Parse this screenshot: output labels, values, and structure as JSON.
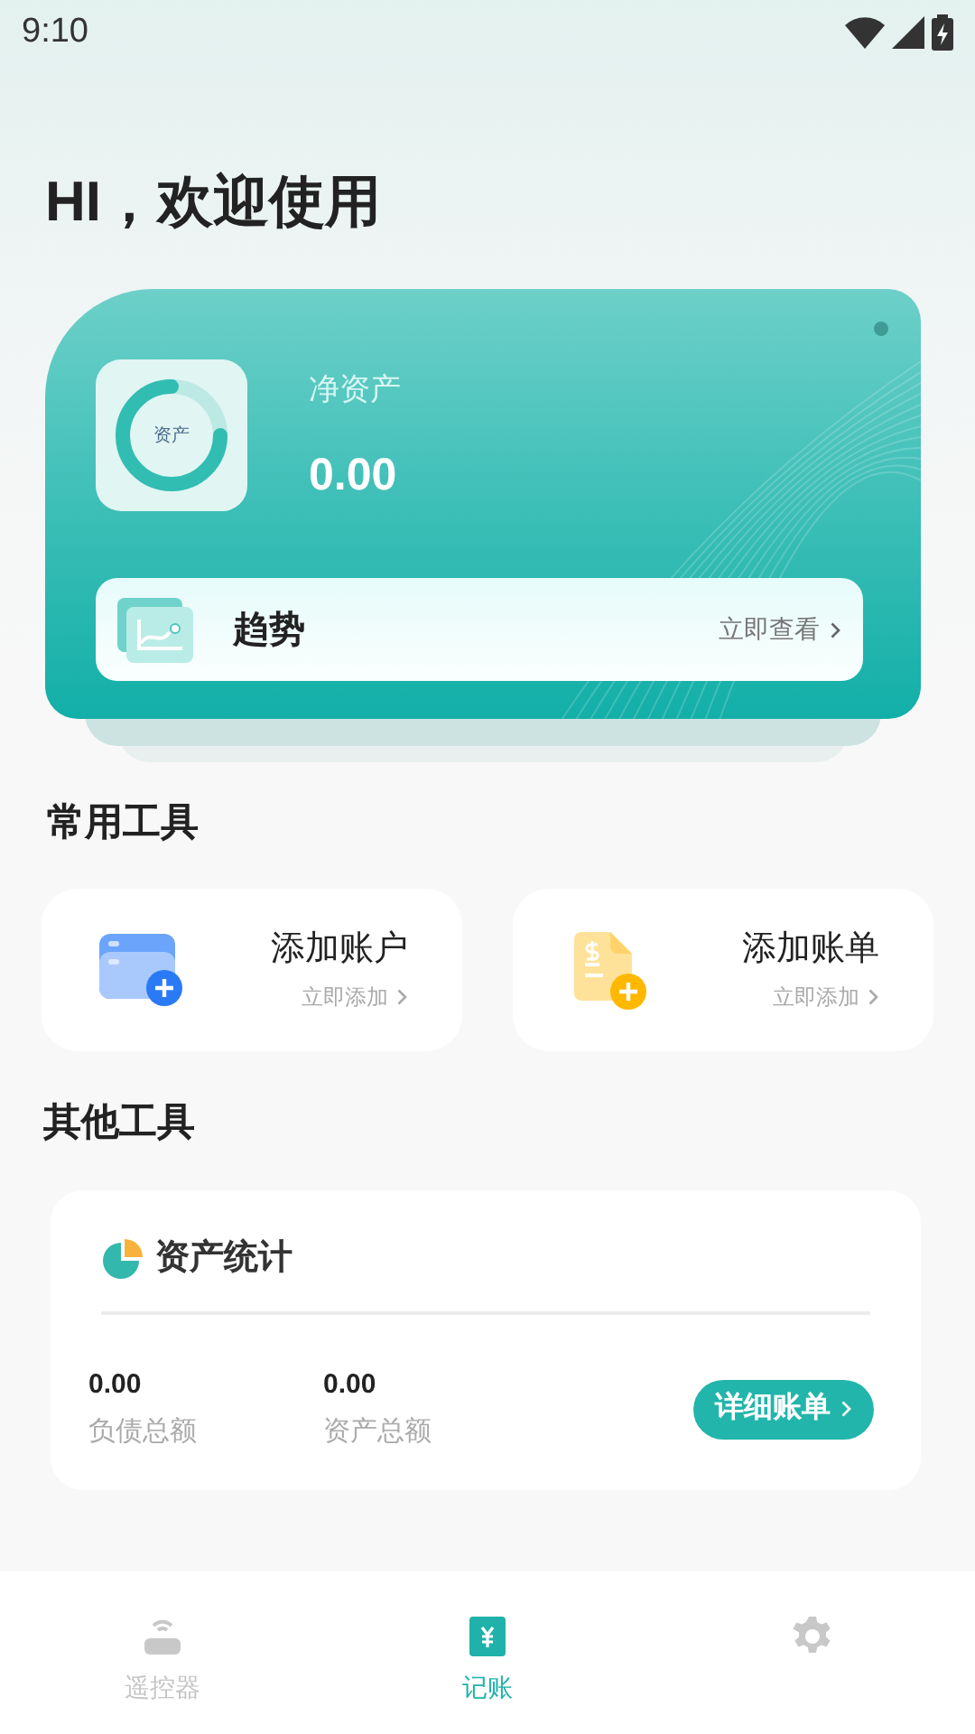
{
  "status_bar": {
    "time": "9:10"
  },
  "greeting": "HI，欢迎使用",
  "asset_card": {
    "icon_label": "资产",
    "title": "净资产",
    "value": "0.00",
    "trend": {
      "label": "趋势",
      "action": "立即查看"
    }
  },
  "common_tools": {
    "title": "常用工具",
    "items": [
      {
        "kind": "account",
        "label": "添加账户",
        "action": "立即添加"
      },
      {
        "kind": "bill",
        "label": "添加账单",
        "action": "立即添加"
      }
    ]
  },
  "other_tools": {
    "title": "其他工具",
    "stats": {
      "title": "资产统计",
      "figures": [
        {
          "value": "0.00",
          "label": "负债总额"
        },
        {
          "value": "0.00",
          "label": "资产总额"
        }
      ],
      "button": "详细账单"
    }
  },
  "bottom_nav": [
    {
      "kind": "remote",
      "label": "遥控器",
      "selected": false
    },
    {
      "kind": "ledger",
      "label": "记账",
      "selected": true
    },
    {
      "kind": "settings",
      "selected": false
    }
  ]
}
